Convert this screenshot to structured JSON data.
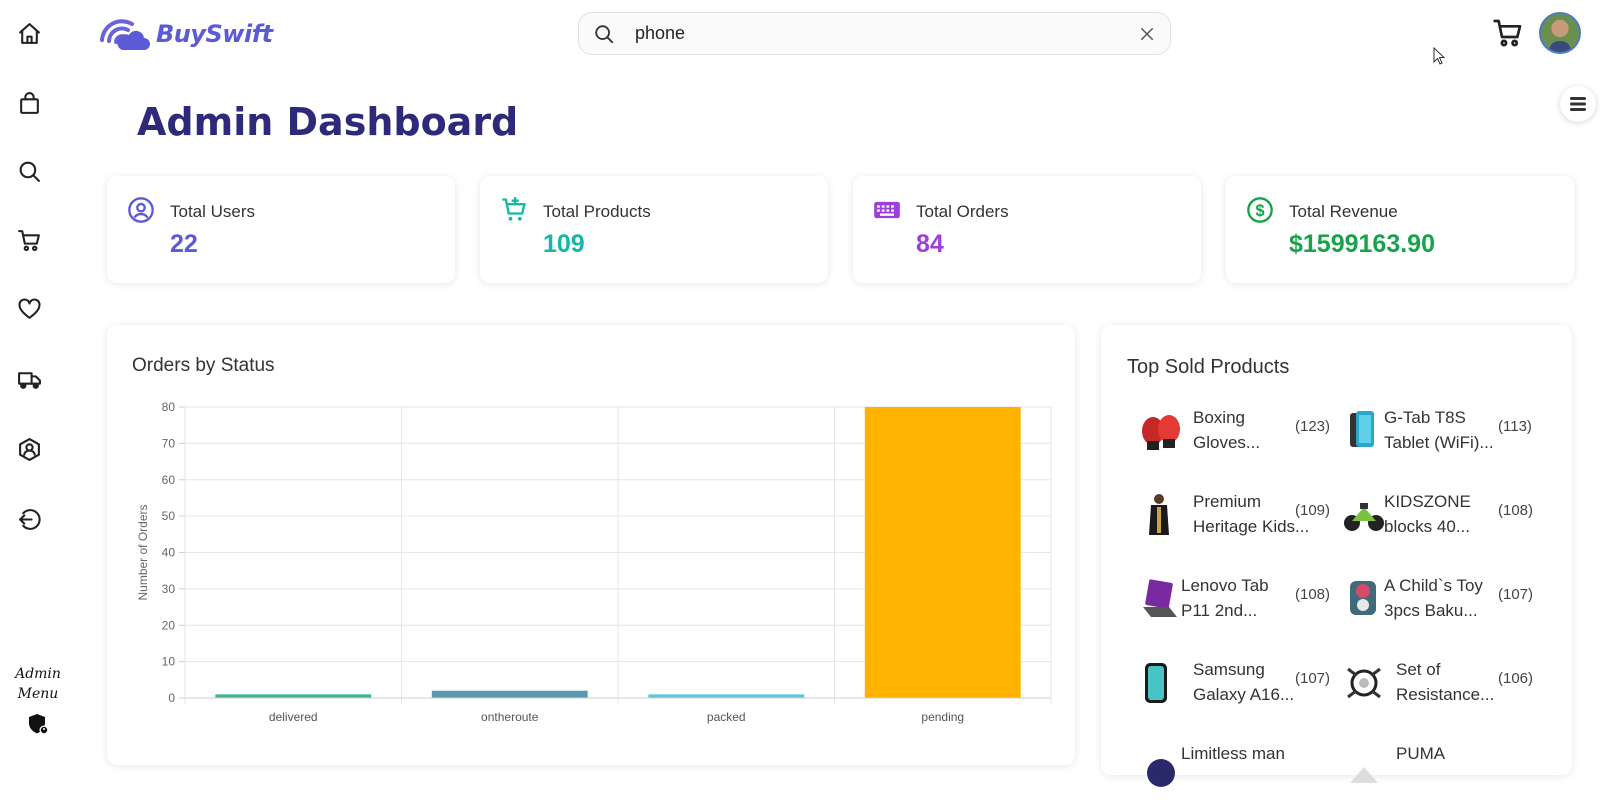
{
  "brand": {
    "name": "BuySwift",
    "accent": "#5b5bd6"
  },
  "search": {
    "value": "phone",
    "placeholder": ""
  },
  "sidebar": {
    "items": [
      {
        "icon": "home-icon"
      },
      {
        "icon": "shopping-bag-icon"
      },
      {
        "icon": "search-icon"
      },
      {
        "icon": "cart-icon"
      },
      {
        "icon": "heart-icon"
      },
      {
        "icon": "truck-icon"
      },
      {
        "icon": "user-shield-icon"
      },
      {
        "icon": "logout-icon"
      }
    ],
    "admin_menu_line1": "Admin",
    "admin_menu_line2": "Menu"
  },
  "page": {
    "title": "Admin Dashboard"
  },
  "stats": [
    {
      "label": "Total Users",
      "value": "22",
      "color": "#5b5bd6",
      "icon": "user-circle-icon"
    },
    {
      "label": "Total Products",
      "value": "109",
      "color": "#14b8a6",
      "icon": "cart-plus-icon"
    },
    {
      "label": "Total Orders",
      "value": "84",
      "color": "#9b3fe0",
      "icon": "keyboard-icon"
    },
    {
      "label": "Total Revenue",
      "value": "$1599163.90",
      "color": "#16a34a",
      "icon": "dollar-circle-icon"
    }
  ],
  "orders_panel": {
    "title": "Orders by Status"
  },
  "chart_data": {
    "type": "bar",
    "title": "",
    "xlabel": "",
    "ylabel": "Number of Orders",
    "categories": [
      "delivered",
      "ontheroute",
      "packed",
      "pending"
    ],
    "values": [
      1,
      2,
      1,
      80
    ],
    "colors": [
      "#3fb58f",
      "#5a97b0",
      "#5ec8db",
      "#ffb300"
    ],
    "ylim": [
      0,
      80
    ],
    "yticks": [
      0,
      10,
      20,
      30,
      40,
      50,
      60,
      70,
      80
    ],
    "grid": true,
    "legend": "none"
  },
  "top_products": {
    "title": "Top Sold Products",
    "items": [
      {
        "line1": "Boxing",
        "line2": "Gloves...",
        "count": "(123)"
      },
      {
        "line1": "G-Tab T8S",
        "line2": "Tablet (WiFi)...",
        "count": "(113)"
      },
      {
        "line1": "Premium",
        "line2": "Heritage Kids...",
        "count": "(109)"
      },
      {
        "line1": "KIDSZONE",
        "line2": "blocks 40...",
        "count": "(108)"
      },
      {
        "line1": "Lenovo Tab",
        "line2": "P11 2nd...",
        "count": "(108)"
      },
      {
        "line1": "A Child`s Toy",
        "line2": "3pcs Baku...",
        "count": "(107)"
      },
      {
        "line1": "Samsung",
        "line2": "Galaxy A16...",
        "count": "(107)"
      },
      {
        "line1": "Set of",
        "line2": "Resistance...",
        "count": "(106)"
      },
      {
        "line1": "Limitless man",
        "line2": "",
        "count": ""
      },
      {
        "line1": "PUMA",
        "line2": "",
        "count": ""
      }
    ]
  }
}
